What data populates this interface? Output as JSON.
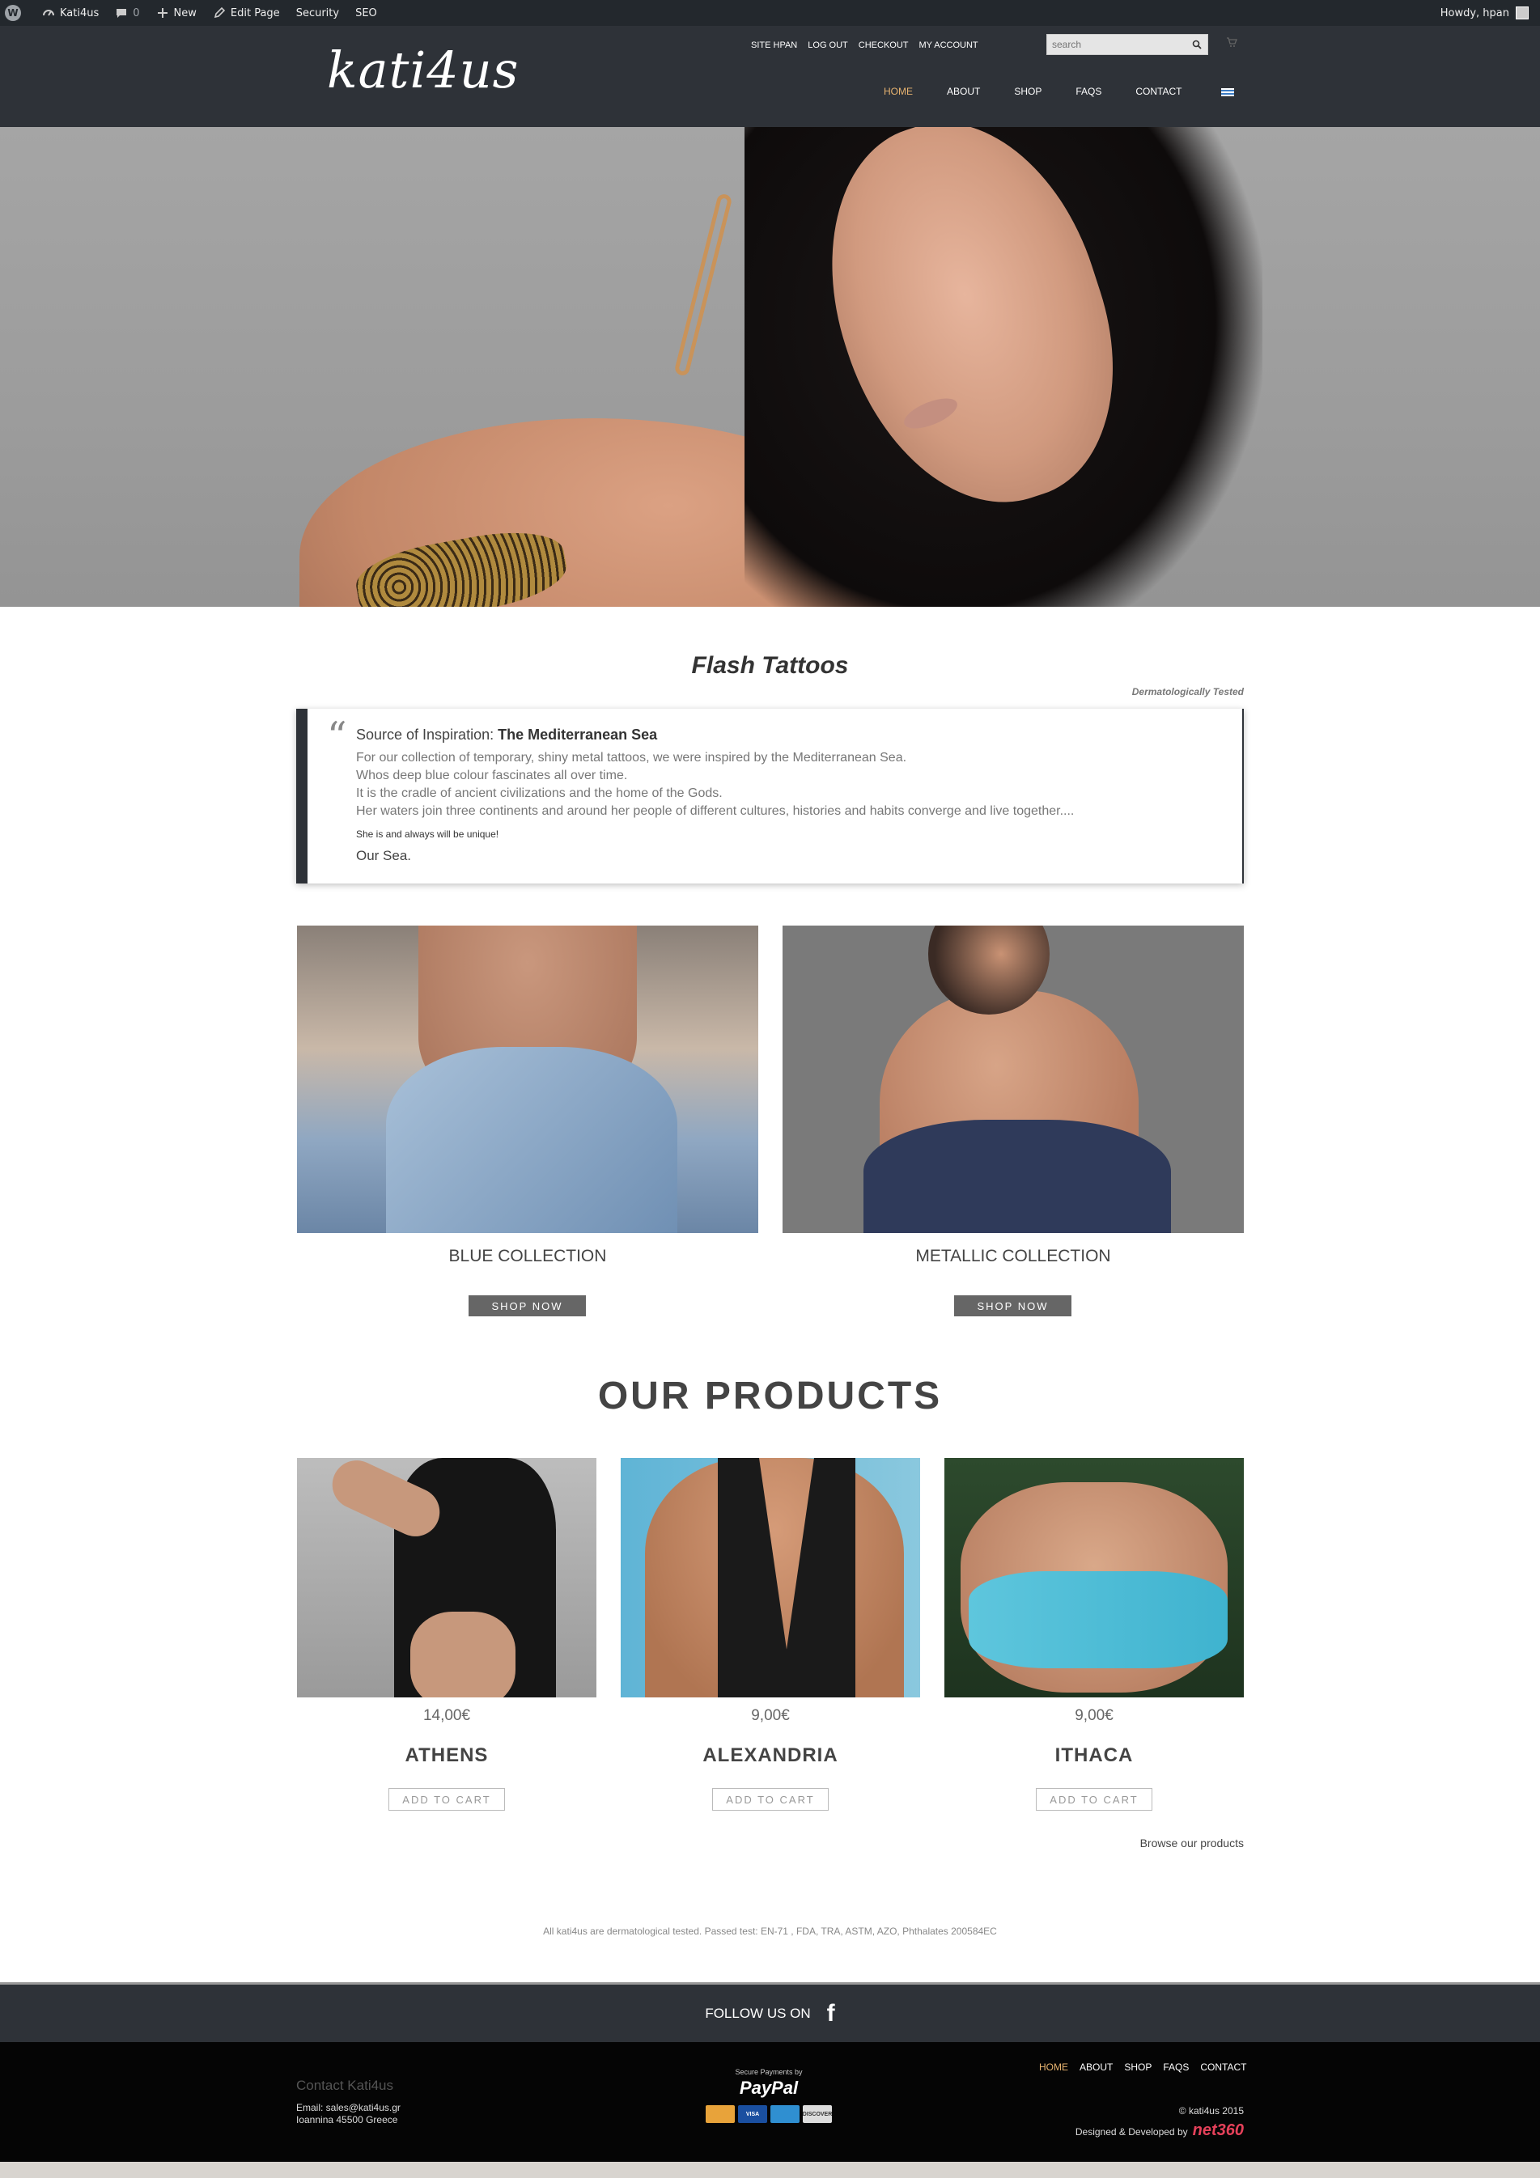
{
  "admin_bar": {
    "site_name": "Kati4us",
    "comments_count": "0",
    "new_label": "New",
    "edit_label": "Edit Page",
    "security_label": "Security",
    "seo_label": "SEO",
    "greeting": "Howdy, hpan"
  },
  "header": {
    "logo_text": "kati4us",
    "top_links": [
      "SITE HPAN",
      "LOG OUT",
      "CHECKOUT",
      "MY ACCOUNT"
    ],
    "search_placeholder": "search",
    "main_nav": [
      {
        "label": "HOME",
        "active": true
      },
      {
        "label": "ABOUT",
        "active": false
      },
      {
        "label": "SHOP",
        "active": false
      },
      {
        "label": "FAQS",
        "active": false
      },
      {
        "label": "CONTACT",
        "active": false
      }
    ],
    "accent_color": "#e8b470",
    "background_color": "#2e3238"
  },
  "hero": {
    "slides_count": 4,
    "active_slide": 1
  },
  "intro": {
    "title": "Flash Tattoos",
    "tagline": "Dermatologically Tested",
    "quote_prefix": "Source of Inspiration: ",
    "quote_emphasis": "The Mediterranean Sea",
    "quote_lines": [
      "For our collection of temporary, shiny metal tattoos, we were inspired by the Mediterranean Sea.",
      "Whos deep blue colour fascinates all over time.",
      "It is the cradle of ancient civilizations and the home of the Gods.",
      "Her waters join three continents and around her people of different cultures, histories and habits converge and live together...."
    ],
    "quote_small": "She is and always will be unique!",
    "quote_end": "Our Sea."
  },
  "collections": [
    {
      "title": "BLUE COLLECTION",
      "button": "SHOP NOW"
    },
    {
      "title": "METALLIC COLLECTION",
      "button": "SHOP NOW"
    }
  ],
  "products": {
    "title": "OUR PRODUCTS",
    "items": [
      {
        "price": "14,00€",
        "name": "ATHENS",
        "button": "ADD TO CART"
      },
      {
        "price": "9,00€",
        "name": "ALEXANDRIA",
        "button": "ADD TO CART"
      },
      {
        "price": "9,00€",
        "name": "ITHACA",
        "button": "ADD TO CART"
      }
    ],
    "browse_link": "Browse our products"
  },
  "tested_note": "All kati4us are dermatological tested. Passed test: EN-71 , FDA, TRA, ASTM, AZO, Phthalates 200584EC",
  "follow": {
    "label": "FOLLOW US ON",
    "icon": "facebook-icon"
  },
  "footer": {
    "contact_title": "Contact Kati4us",
    "email_line": "Email: sales@kati4us.gr",
    "address_line": "Ioannina 45500 Greece",
    "paypal_small": "Secure Payments by",
    "paypal_brand": "PayPal",
    "cards": [
      "MasterCard",
      "VISA",
      "AMEX",
      "DISCOVER"
    ],
    "nav": [
      {
        "label": "HOME",
        "active": true
      },
      {
        "label": "ABOUT",
        "active": false
      },
      {
        "label": "SHOP",
        "active": false
      },
      {
        "label": "FAQS",
        "active": false
      },
      {
        "label": "CONTACT",
        "active": false
      }
    ],
    "copyright": "© kati4us 2015",
    "developed_by": "Designed & Developed by",
    "developer_brand": "net360"
  }
}
